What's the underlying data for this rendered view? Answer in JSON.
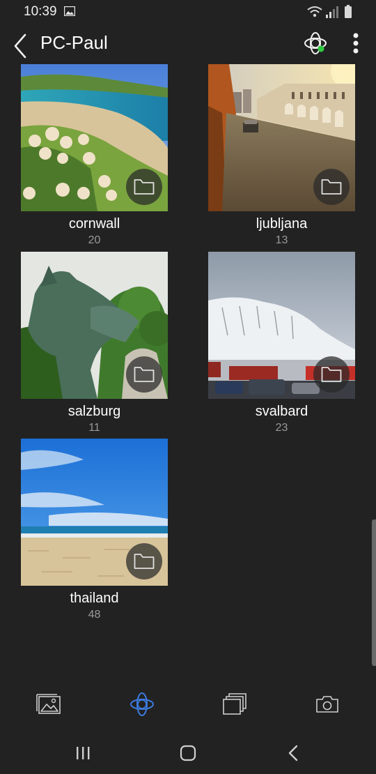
{
  "status_bar": {
    "time": "10:39"
  },
  "app_bar": {
    "title": "PC-Paul",
    "back_icon": "chevron-left-icon",
    "sync_icon": "sync-orbit-icon",
    "more_icon": "more-vert-icon",
    "sync_badge_color": "#2ecc40"
  },
  "albums": [
    {
      "name": "cornwall",
      "count": "20"
    },
    {
      "name": "ljubljana",
      "count": "13"
    },
    {
      "name": "salzburg",
      "count": "11"
    },
    {
      "name": "svalbard",
      "count": "23"
    },
    {
      "name": "thailand",
      "count": "48"
    }
  ],
  "bottom_tabs": [
    {
      "icon": "gallery-icon"
    },
    {
      "icon": "sync-orbit-icon",
      "active": true
    },
    {
      "icon": "albums-stack-icon"
    },
    {
      "icon": "camera-icon"
    }
  ],
  "colors": {
    "accent": "#3d7be0",
    "background": "#222222",
    "count_text": "#9a9a9a"
  }
}
